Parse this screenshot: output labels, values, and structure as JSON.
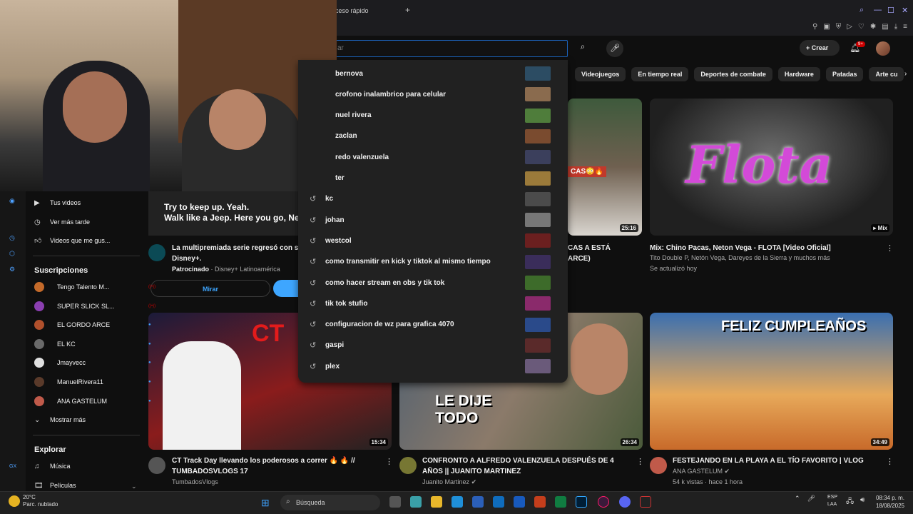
{
  "browser": {
    "tab_title": "ceso rápido",
    "new_tab": "+"
  },
  "search": {
    "placeholder": "ar",
    "icon": "search-icon",
    "mic_icon": "mic-icon"
  },
  "header": {
    "create_label": "Crear",
    "notif_badge": "9+"
  },
  "chips": [
    "Videojuegos",
    "En tiempo real",
    "Deportes de combate",
    "Hardware",
    "Patadas",
    "Arte cu"
  ],
  "suggestions": [
    {
      "text": "bernova",
      "history": false,
      "thumb": "#2c4c63"
    },
    {
      "text": "crofono inalambrico para celular",
      "history": false,
      "thumb": "#8a6b4e"
    },
    {
      "text": "nuel rivera",
      "history": false,
      "thumb": "#4f7d3b"
    },
    {
      "text": "zaclan",
      "history": false,
      "thumb": "#7a4b2f"
    },
    {
      "text": "redo valenzuela",
      "history": false,
      "thumb": "#3b3f5c"
    },
    {
      "text": "ter",
      "history": false,
      "thumb": "#9b7a3a"
    },
    {
      "text": "kc",
      "history": true,
      "thumb": "#4b4b4b"
    },
    {
      "text": "johan",
      "history": true,
      "thumb": "#777777"
    },
    {
      "text": "westcol",
      "history": true,
      "thumb": "#6b1f1f"
    },
    {
      "text": "como transmitir en kick y tiktok al mismo tiempo",
      "history": true,
      "thumb": "#3a2d5a"
    },
    {
      "text": "como hacer stream en obs y tik tok",
      "history": true,
      "thumb": "#3d6b2a"
    },
    {
      "text": "tik tok stufio",
      "history": true,
      "thumb": "#8a2a6b"
    },
    {
      "text": "configuracion de wz para grafica 4070",
      "history": true,
      "thumb": "#2a4a8a"
    },
    {
      "text": "gaspi",
      "history": true,
      "thumb": "#5a2a2a"
    },
    {
      "text": "plex",
      "history": true,
      "thumb": "#6a5a7a"
    }
  ],
  "sidebar": {
    "items": [
      {
        "label": "Tus videos",
        "icon": "play-square-icon"
      },
      {
        "label": "Ver más tarde",
        "icon": "clock-icon"
      },
      {
        "label": "Videos que me gus...",
        "icon": "thumbs-up-icon"
      }
    ],
    "subs_heading": "Suscripciones",
    "subscriptions": [
      {
        "name": "Tengo Talento M...",
        "color": "#c46a2a",
        "live": true
      },
      {
        "name": "SUPER SLICK SL...",
        "color": "#8b3fb0",
        "live": true
      },
      {
        "name": "EL GORDO ARCE",
        "color": "#b0502c",
        "live": false
      },
      {
        "name": "EL KC",
        "color": "#6a6a6a",
        "live": false
      },
      {
        "name": "Jmayvecc",
        "color": "#e0e0e0",
        "live": false
      },
      {
        "name": "ManuelRivera11",
        "color": "#5a3a2a",
        "live": false
      },
      {
        "name": "ANA GASTELUM",
        "color": "#c05a4a",
        "live": false
      }
    ],
    "show_more": "Mostrar más",
    "explore_heading": "Explorar",
    "explore": [
      {
        "label": "Música",
        "icon": "music-icon"
      },
      {
        "label": "Películas",
        "icon": "film-icon"
      }
    ]
  },
  "ad": {
    "overlay_line1": "Try to keep up. Yeah.",
    "overlay_line2": "Walk like a Jeep. Here you go, Ne",
    "title_line1": "La multipremiada serie regresó con s",
    "title_line2": "Disney+.",
    "sponsored": "Patrocinado",
    "advertiser": "Disney+ Latinoamérica",
    "button": "Mirar"
  },
  "videos": [
    {
      "title": "CAS A ESTÁ ARCE)",
      "line1": "CAS A ESTÁ",
      "line2": "ARCE)",
      "duration": "25:16",
      "channel": "",
      "meta": ""
    },
    {
      "title": "Mix: Chino Pacas, Neton Vega - FLOTA [Video Oficial]",
      "line1": "Mix: Chino Pacas, Neton Vega - FLOTA [Video Oficial]",
      "line2": "",
      "duration": "Mix",
      "channel": "Tito Double P, Netón Vega, Dareyes de la Sierra y muchos más",
      "meta": "Se actualizó hoy",
      "thumb_text": "Flota"
    },
    {
      "line1": "CT Track Day llevando los poderosos a correr 🔥 🔥 //",
      "line2": "TUMBADOSVLOGS 17",
      "duration": "15:34",
      "channel": "TumbadosVlogs",
      "meta": "",
      "thumb_text": "CT"
    },
    {
      "line1": "CONFRONTO A ALFREDO VALENZUELA DESPUÉS DE 4",
      "line2": "AÑOS || JUANITO MARTINEZ",
      "duration": "26:34",
      "channel": "Juanito Martinez",
      "meta": "",
      "thumb_text": "LE DIJE TODO"
    },
    {
      "line1": "FESTEJANDO EN LA PLAYA A EL TÍO FAVORITO | VLOG",
      "line2": "",
      "duration": "34:49",
      "channel": "ANA GASTELUM",
      "meta": "54 k vistas · hace 1 hora",
      "thumb_text": "FELIZ CUMPLEAÑOS"
    }
  ],
  "taskbar": {
    "temp": "20°C",
    "weather": "Parc. nublado",
    "search": "Búsqueda",
    "lang1": "ESP",
    "lang2": "LAA",
    "time": "08:34 p. m.",
    "date": "18/08/2025"
  }
}
